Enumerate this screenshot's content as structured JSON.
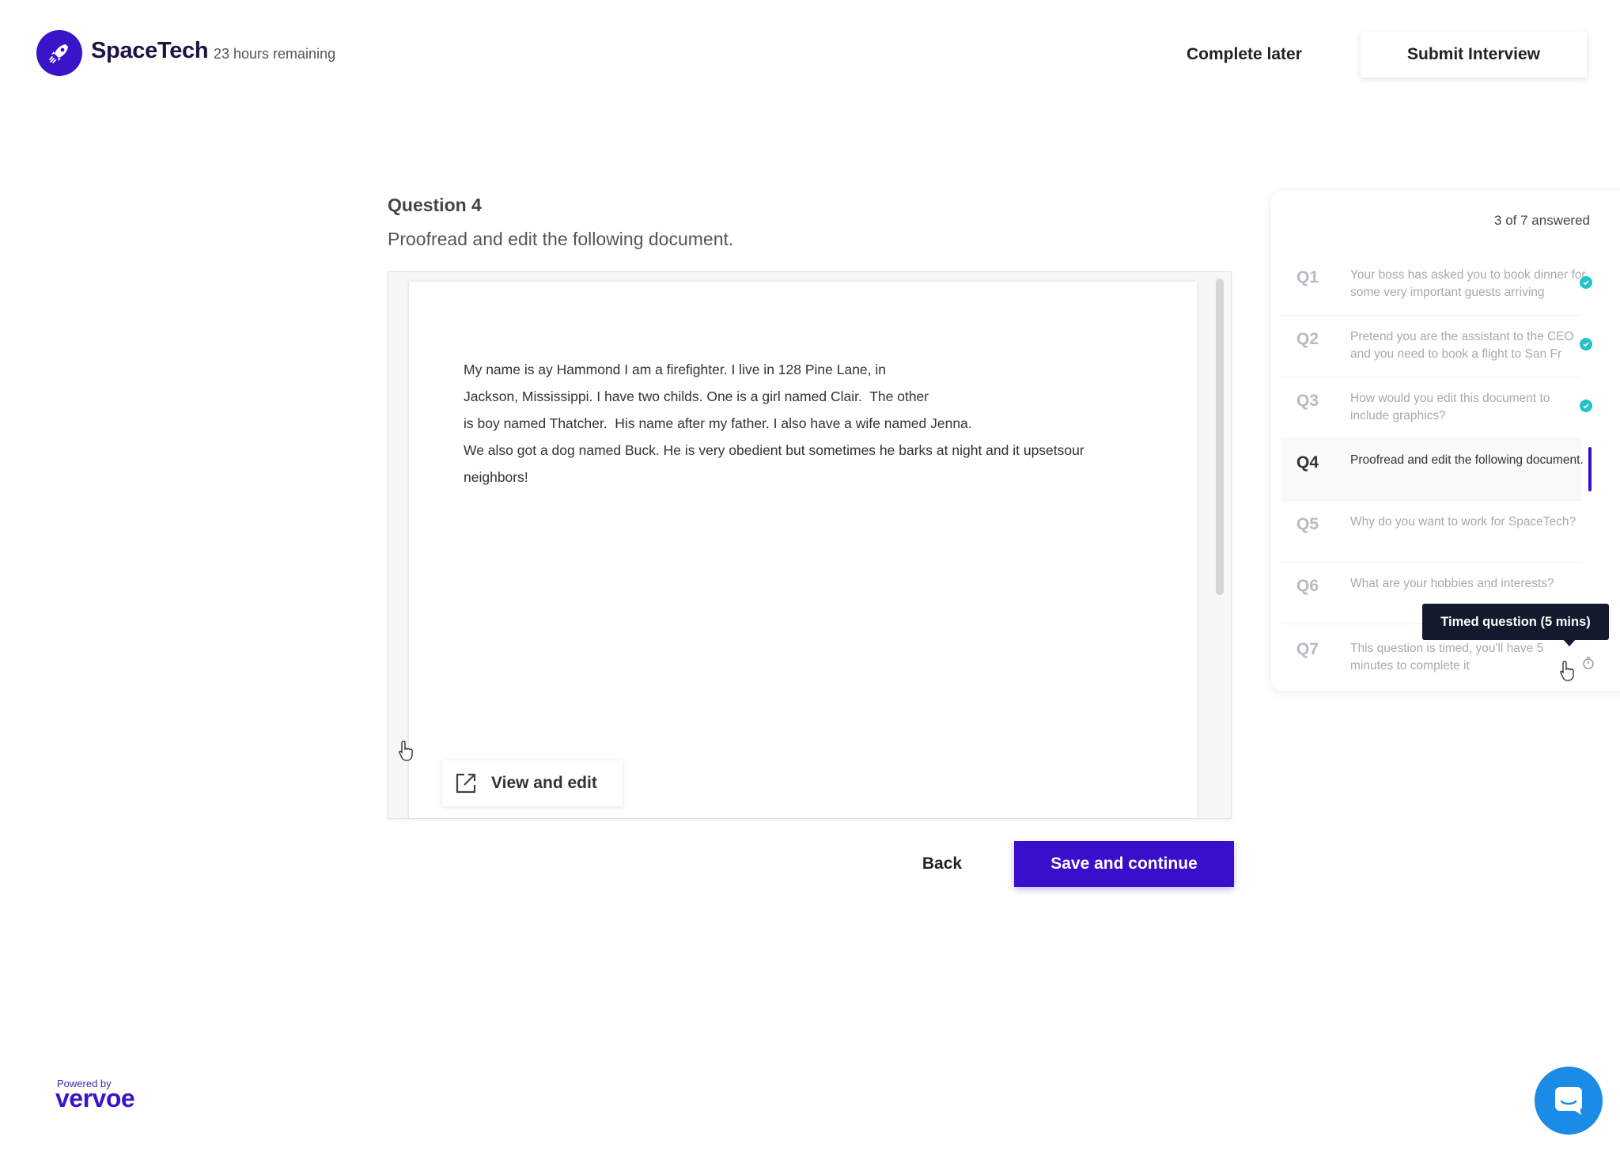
{
  "header": {
    "brand": "SpaceTech",
    "time_remaining": "23 hours remaining",
    "complete_later": "Complete later",
    "submit": "Submit Interview"
  },
  "question": {
    "number": "Question 4",
    "prompt": "Proofread and edit the following document.",
    "document_lines": [
      "My name is ay Hammond I am a firefighter. I live in 128 Pine Lane, in",
      "Jackson, Mississippi. I have two childs. One is a girl named Clair.  The other",
      "is boy named Thatcher.  His name after my father. I also have a wife named Jenna.",
      "We also got a dog named Buck. He is very obedient but sometimes he barks at night and it upsetsour",
      "neighbors!"
    ],
    "view_edit": "View and edit"
  },
  "actions": {
    "back": "Back",
    "save": "Save and continue"
  },
  "sidebar": {
    "answered": "3 of 7 answered",
    "items": [
      {
        "code": "Q1",
        "text": "Your boss has asked you to book dinner for some very important  guests arriving",
        "answered": true
      },
      {
        "code": "Q2",
        "text": "Pretend you are the assistant to the CEO and you need to book a flight to San Fr",
        "answered": true
      },
      {
        "code": "Q3",
        "text": "How would you edit this document to include graphics?",
        "answered": true
      },
      {
        "code": "Q4",
        "text": "Proofread and edit the following document.",
        "answered": false,
        "active": true
      },
      {
        "code": "Q5",
        "text": "Why do you want to work for SpaceTech?",
        "answered": false
      },
      {
        "code": "Q6",
        "text": "What are your hobbies and interests?",
        "answered": false
      },
      {
        "code": "Q7",
        "text": "This question is timed, you'll have 5 minutes to complete it",
        "answered": false,
        "timed": true
      }
    ],
    "tooltip": "Timed question (5 mins)"
  },
  "footer": {
    "powered_by": "Powered by",
    "vendor": "vervoe"
  },
  "colors": {
    "accent": "#3a0fcc",
    "check": "#25c2c6",
    "chat": "#1a8ce6"
  }
}
